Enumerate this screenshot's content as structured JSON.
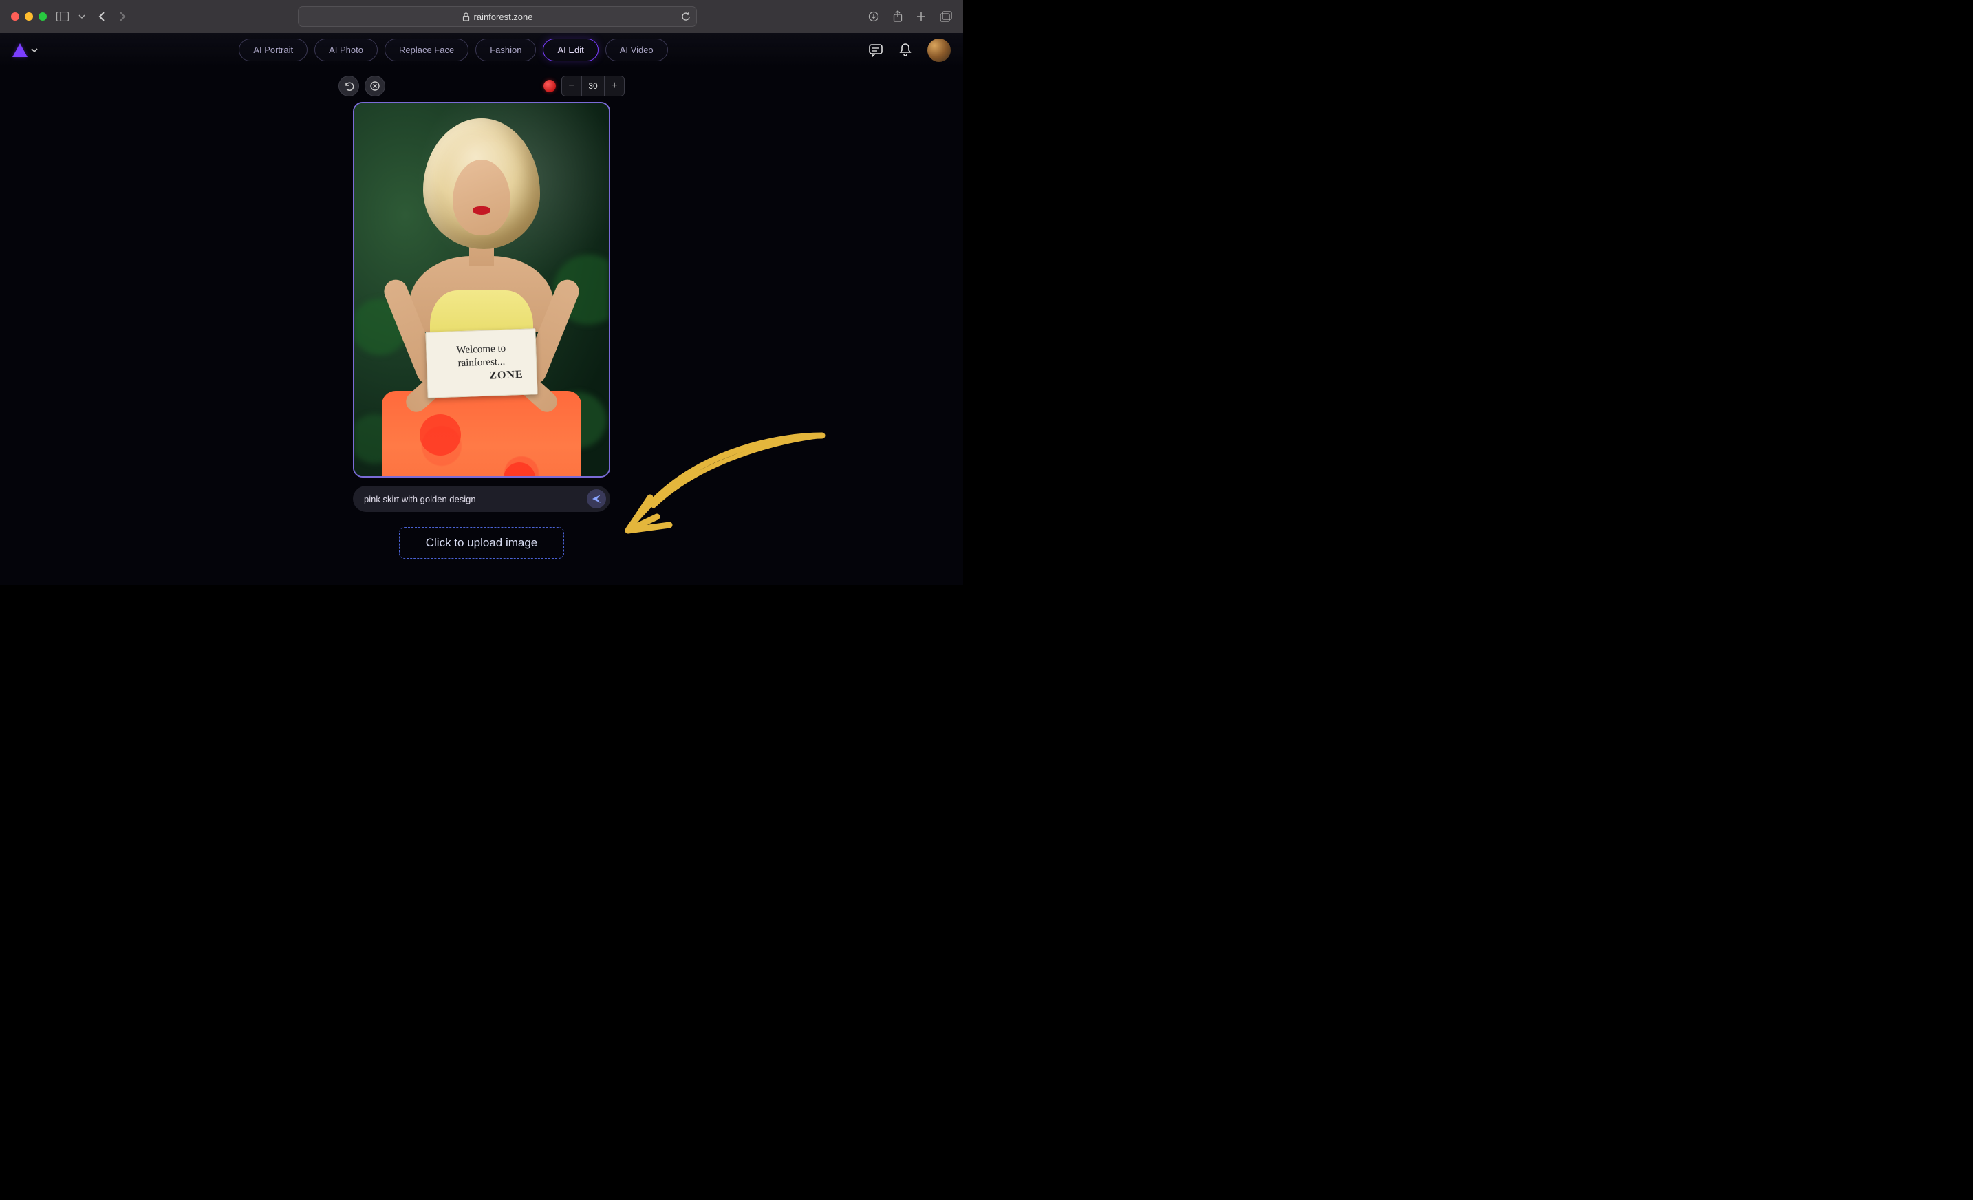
{
  "browser": {
    "url": "rainforest.zone"
  },
  "nav": {
    "tabs": [
      {
        "label": "AI Portrait",
        "active": false
      },
      {
        "label": "AI Photo",
        "active": false
      },
      {
        "label": "Replace Face",
        "active": false
      },
      {
        "label": "Fashion",
        "active": false
      },
      {
        "label": "AI Edit",
        "active": true
      },
      {
        "label": "AI Video",
        "active": false
      }
    ]
  },
  "brush": {
    "size": "30"
  },
  "sign": {
    "line1": "Welcome to",
    "line2": "rainforest...",
    "line3": "ZONE"
  },
  "prompt": {
    "value": "pink skirt with golden design"
  },
  "upload": {
    "label": "Click to upload image"
  }
}
